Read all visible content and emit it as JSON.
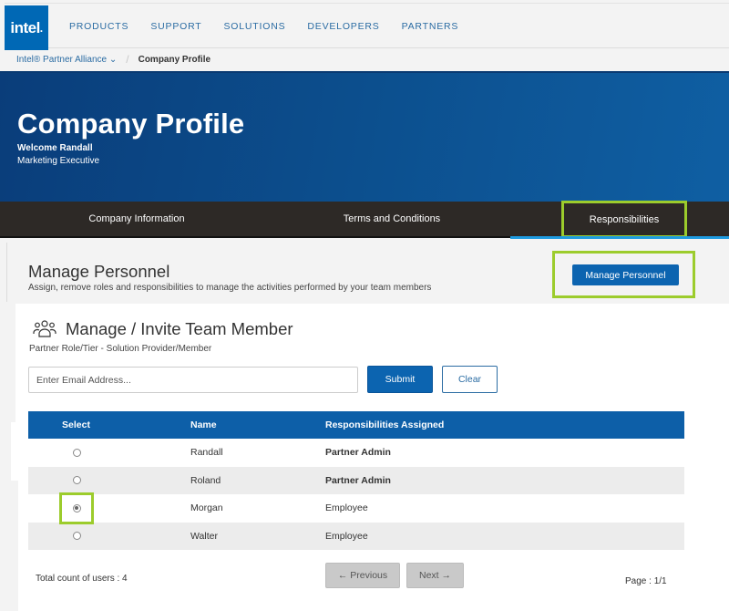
{
  "header": {
    "logo": "intel",
    "nav": [
      "PRODUCTS",
      "SUPPORT",
      "SOLUTIONS",
      "DEVELOPERS",
      "PARTNERS"
    ]
  },
  "breadcrumb": {
    "parent": "Intel® Partner Alliance ⌄",
    "current": "Company Profile"
  },
  "banner": {
    "title": "Company Profile",
    "welcome": "Welcome Randall",
    "role": "Marketing Executive"
  },
  "tabs": [
    {
      "label": "Company Information",
      "active": false
    },
    {
      "label": "Terms and Conditions",
      "active": false
    },
    {
      "label": "Responsibilities",
      "active": true
    }
  ],
  "section": {
    "title": "Manage Personnel",
    "description": "Assign, remove roles and responsibilities to manage the activities performed by your team members",
    "button": "Manage Personnel"
  },
  "team": {
    "icon": "people-group-icon",
    "title": "Manage / Invite Team Member",
    "tier": "Partner Role/Tier - Solution Provider/Member",
    "email_placeholder": "Enter Email Address...",
    "email_value": "",
    "submit": "Submit",
    "clear": "Clear"
  },
  "table": {
    "columns": [
      "Select",
      "Name",
      "Responsibilities Assigned"
    ],
    "rows": [
      {
        "selected": false,
        "name": "Randall",
        "responsibility": "Partner Admin",
        "bold": true
      },
      {
        "selected": false,
        "name": "Roland",
        "responsibility": "Partner Admin",
        "bold": true
      },
      {
        "selected": true,
        "name": "Morgan",
        "responsibility": "Employee",
        "bold": false
      },
      {
        "selected": false,
        "name": "Walter",
        "responsibility": "Employee",
        "bold": false
      }
    ]
  },
  "footer": {
    "total": "Total count of users : 4",
    "previous": "← Previous",
    "next": "Next →",
    "page": "Page : 1/1"
  },
  "colors": {
    "brand_blue": "#0068b5",
    "table_header": "#0d5fa8",
    "highlight": "#9ccc2c",
    "tab_bar": "#2d2926"
  }
}
